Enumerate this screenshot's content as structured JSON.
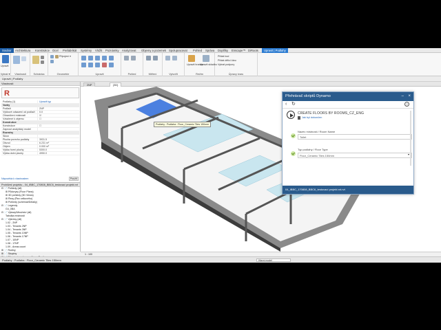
{
  "ribbon": {
    "file_tab": "Soubor",
    "tabs": [
      "Architektura",
      "Konstrukce",
      "Ocel",
      "Prefabrikát",
      "Systémy",
      "Vložit",
      "Poznámky",
      "Analyzovat",
      "Objemy a pozemek",
      "Spolupracovat",
      "Pohled",
      "Správa",
      "Doplňky",
      "Enscape™",
      "DiRoots",
      "Upravit | Podlahy"
    ],
    "active_tab": "Upravit | Podlahy",
    "panels": [
      {
        "label": "Vybrat ▾",
        "buttons": [
          "Upravit"
        ]
      },
      {
        "label": "Vlastnosti",
        "buttons": []
      },
      {
        "label": "Schránka",
        "buttons": []
      },
      {
        "label": "Geometrie",
        "buttons": [
          "Připojení ▾"
        ]
      },
      {
        "label": "Upravit",
        "buttons": []
      },
      {
        "label": "Pohled",
        "buttons": []
      },
      {
        "label": "Měření",
        "buttons": []
      },
      {
        "label": "Vytvořit",
        "buttons": []
      },
      {
        "label": "Režim",
        "buttons": [
          "Upravit hranice",
          "Upravit skladbu"
        ]
      },
      {
        "label": "Úpravy tvaru",
        "buttons": [
          "Přidat bod",
          "Přidat dělicí čáru",
          "Vybrat podpory"
        ]
      }
    ]
  },
  "options_bar": "Upravit | Podlahy",
  "properties": {
    "header": "Vlastnosti",
    "type_dropdown": "Podlahy (1)",
    "edit_type": "Upravit typ",
    "sections": [
      {
        "title": "Vazby",
        "rows": [
          [
            "Podlaží",
            "2NP"
          ],
          [
            "Výškové odsazení od podlaží",
            "0.0"
          ],
          [
            "Ohraničení místnosti",
            "☑"
          ],
          [
            "Vztažené k objemu",
            "☐"
          ]
        ]
      },
      {
        "title": "Konstrukce",
        "rows": [
          [
            "Konstrukce",
            "☐"
          ],
          [
            "Zapnout analytický model",
            ""
          ]
        ]
      },
      {
        "title": "Rozměry",
        "rows": [
          [
            "Sklon",
            ""
          ],
          [
            "Plocha povrchu podlahy",
            "3931.5"
          ],
          [
            "Obvod",
            "6.231 m²"
          ],
          [
            "Objem",
            "0.000 m³"
          ],
          [
            "Výška horní plochy",
            "5300.0"
          ],
          [
            "Výška dolní plochy",
            "4950.0"
          ]
        ]
      }
    ],
    "help_link": "Nápověda k vlastnostem",
    "apply": "Použít"
  },
  "browser": {
    "header": "Prohlížeč projektu - 04_IBBC_170808_BBC6_testovací projekt.rvt",
    "items": [
      "⊟ 📄 Pohledy (all)",
      "  ⊞ Půdorysy (Floor Plans)",
      "  ⊞ 3D pohledy (3D Views)",
      "  ⊞ Řezy (Řez celkového)",
      "  ⊞ Pohledy (schémat/Detaily)",
      "⊟ 📄 Legendy",
      "  G4_0BA",
      "⊟ 📄 Výkazy/Množství (all)",
      "  Tabulka místností",
      "⊟ 📄 Výkresy (all)",
      "  1.02 - 2NP",
      "  1.03 - Tenants 2NP",
      "  1.04 - Tenants 3NP",
      "  1.05 - Tenants 10NP",
      "  1.06 - Tenants 17NP",
      "  1.07 - 10NP",
      "  1.08 - 17NP",
      "  1.09 - Areas count",
      "⊞ 📄 Rodiny",
      "⊞ 📄 Skupiny",
      "⊞ 📄 Připojené soubory aplikace Revit"
    ]
  },
  "view_tabs": [
    "2NP",
    "{3D}"
  ],
  "active_view_tab": "{3D}",
  "viewport": {
    "tooltip": "Podlahy : Podlaha : Floor_Ceramic Tiles 150mm"
  },
  "view_bar": {
    "scale": "1 : 100"
  },
  "status_bar": {
    "text": "Podlahy : Podlaha : Floor_Ceramic Tiles 150mm",
    "model": "Hlavní model"
  },
  "dynamo": {
    "title": "Přehrávač skriptů Dynamo",
    "script_name": "CREATE FLOORS BY ROOMS_CZ_ENG",
    "subtitle": "Jak byl dokončen",
    "field1_label": "Název místnosti / Room Name",
    "field1_value": "Toilet",
    "field2_label": "Typ podlahy / Floor Type",
    "field2_value": "Floor_Ceramic Tiles 150mm",
    "footer": "04_IBBC_170808_BBC6_testovací projekt.rvt.rvt"
  },
  "colors": {
    "accent": "#2b7bd1",
    "dynamo_header": "#2a5b8c",
    "selected_floor": "#2d6bdc",
    "tile": "#c9e6ef",
    "wall_dark": "#555555"
  }
}
